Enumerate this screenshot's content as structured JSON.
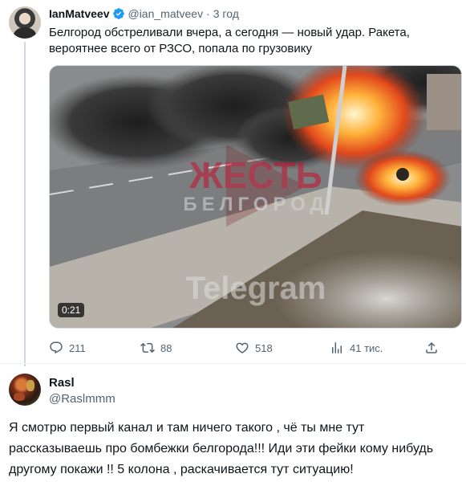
{
  "tweet": {
    "author_name": "IanMatveev",
    "handle": "@ian_matveev",
    "separator": "·",
    "time": "3 год",
    "text": "Белгород обстреливали вчера, а сегодня — новый удар. Ракета, вероятнее всего от РЗСО, попала по грузовику",
    "media": {
      "duration": "0:21",
      "watermark_brand": "ЖЕСТЬ",
      "watermark_city": "БЕЛГОРОД",
      "watermark_channel": "Telegram"
    },
    "actions": {
      "replies": "211",
      "retweets": "88",
      "likes": "518",
      "views": "41 тис."
    },
    "colors": {
      "verified": "#1d9bf0",
      "secondary_text": "#536471",
      "watermark": "#c8102e"
    },
    "icons": [
      "verified-icon",
      "reply-icon",
      "retweet-icon",
      "like-icon",
      "views-icon",
      "share-icon"
    ]
  },
  "reply": {
    "author_name": "Rasl",
    "handle": "@Raslmmm",
    "text": "Я смотрю первый канал и там ничего такого , чё ты мне тут рассказываешь про бомбежки белгорода!!! Иди эти фейки кому нибудь другому покажи !! 5 колона , раскачивается тут ситуацию!"
  }
}
